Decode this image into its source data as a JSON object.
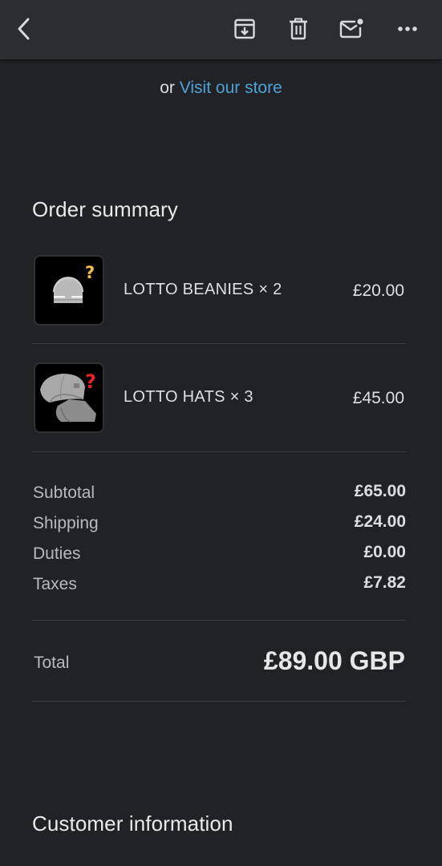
{
  "toolbar": {
    "back_icon": "chevron-left-icon",
    "archive_icon": "archive-download-icon",
    "delete_icon": "trash-icon",
    "mark_unread_icon": "mail-unread-icon",
    "more_icon": "more-horizontal-icon"
  },
  "store_link": {
    "prefix": "or",
    "link_text": "Visit our store"
  },
  "order_summary": {
    "title": "Order summary",
    "items": [
      {
        "name": "LOTTO BEANIES × 2",
        "price": "£20.00",
        "thumbnail": "beanie-mystery-icon"
      },
      {
        "name": "LOTTO HATS × 3",
        "price": "£45.00",
        "thumbnail": "cap-mystery-icon"
      }
    ],
    "costs": [
      {
        "label": "Subtotal",
        "value": "£65.00"
      },
      {
        "label": "Shipping",
        "value": "£24.00"
      },
      {
        "label": "Duties",
        "value": "£0.00"
      },
      {
        "label": "Taxes",
        "value": "£7.82"
      }
    ],
    "total": {
      "label": "Total",
      "value": "£89.00 GBP"
    }
  },
  "customer_information": {
    "title": "Customer information"
  },
  "colors": {
    "background": "#212226",
    "toolbar": "#2b2d31",
    "link": "#4ea2d7",
    "question_yellow": "#f2c43a",
    "question_red": "#e0262b"
  }
}
